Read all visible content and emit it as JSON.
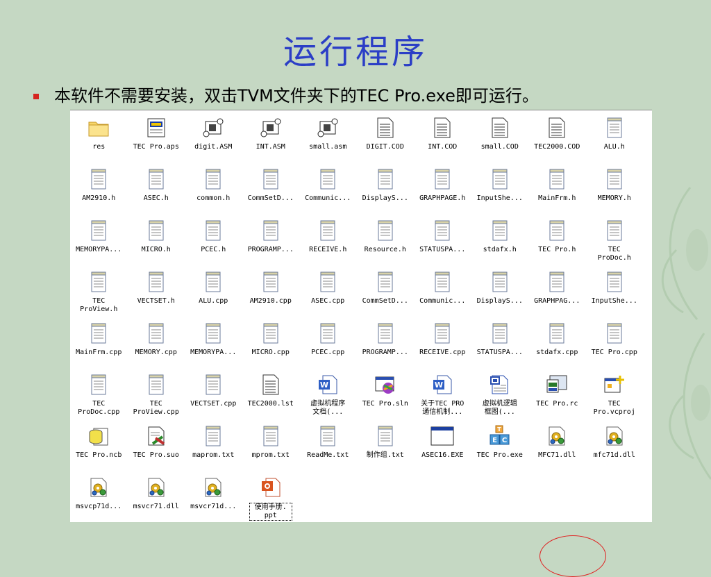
{
  "slide": {
    "title": "运行程序",
    "bullet_prefix": "本软件不需要安装，双击",
    "bullet_tvm": "TVM",
    "bullet_mid": "文件夹下的",
    "bullet_exe": "TEC Pro.exe",
    "bullet_suffix": "即可运行。"
  },
  "explorer": {
    "rows": [
      [
        {
          "label": "res",
          "icon": "folder"
        },
        {
          "label": "TEC Pro.aps",
          "icon": "aps"
        },
        {
          "label": "digit.ASM",
          "icon": "asm"
        },
        {
          "label": "INT.ASM",
          "icon": "asm"
        },
        {
          "label": "small.asm",
          "icon": "asm"
        },
        {
          "label": "DIGIT.COD",
          "icon": "doc"
        },
        {
          "label": "INT.COD",
          "icon": "doc"
        },
        {
          "label": "small.COD",
          "icon": "doc"
        },
        {
          "label": "TEC2000.COD",
          "icon": "doc"
        },
        {
          "label": "ALU.h",
          "icon": "note"
        }
      ],
      [
        {
          "label": "AM2910.h",
          "icon": "note"
        },
        {
          "label": "ASEC.h",
          "icon": "note"
        },
        {
          "label": "common.h",
          "icon": "note"
        },
        {
          "label": "CommSetD...",
          "icon": "note"
        },
        {
          "label": "Communic...",
          "icon": "note"
        },
        {
          "label": "DisplayS...",
          "icon": "note"
        },
        {
          "label": "GRAPHPAGE.h",
          "icon": "note"
        },
        {
          "label": "InputShe...",
          "icon": "note"
        },
        {
          "label": "MainFrm.h",
          "icon": "note"
        },
        {
          "label": "MEMORY.h",
          "icon": "note"
        }
      ],
      [
        {
          "label": "MEMORYPA...",
          "icon": "note"
        },
        {
          "label": "MICRO.h",
          "icon": "note"
        },
        {
          "label": "PCEC.h",
          "icon": "note"
        },
        {
          "label": "PROGRAMP...",
          "icon": "note"
        },
        {
          "label": "RECEIVE.h",
          "icon": "note"
        },
        {
          "label": "Resource.h",
          "icon": "note"
        },
        {
          "label": "STATUSPA...",
          "icon": "note"
        },
        {
          "label": "stdafx.h",
          "icon": "note"
        },
        {
          "label": "TEC Pro.h",
          "icon": "note"
        },
        {
          "label": "TEC\nProDoc.h",
          "icon": "note"
        }
      ],
      [
        {
          "label": "TEC\nProView.h",
          "icon": "note"
        },
        {
          "label": "VECTSET.h",
          "icon": "note"
        },
        {
          "label": "ALU.cpp",
          "icon": "note"
        },
        {
          "label": "AM2910.cpp",
          "icon": "note"
        },
        {
          "label": "ASEC.cpp",
          "icon": "note"
        },
        {
          "label": "CommSetD...",
          "icon": "note"
        },
        {
          "label": "Communic...",
          "icon": "note"
        },
        {
          "label": "DisplayS...",
          "icon": "note"
        },
        {
          "label": "GRAPHPAG...",
          "icon": "note"
        },
        {
          "label": "InputShe...",
          "icon": "note"
        }
      ],
      [
        {
          "label": "MainFrm.cpp",
          "icon": "note"
        },
        {
          "label": "MEMORY.cpp",
          "icon": "note"
        },
        {
          "label": "MEMORYPA...",
          "icon": "note"
        },
        {
          "label": "MICRO.cpp",
          "icon": "note"
        },
        {
          "label": "PCEC.cpp",
          "icon": "note"
        },
        {
          "label": "PROGRAMP...",
          "icon": "note"
        },
        {
          "label": "RECEIVE.cpp",
          "icon": "note"
        },
        {
          "label": "STATUSPA...",
          "icon": "note"
        },
        {
          "label": "stdafx.cpp",
          "icon": "note"
        },
        {
          "label": "TEC Pro.cpp",
          "icon": "note"
        }
      ],
      [
        {
          "label": "TEC\nProDoc.cpp",
          "icon": "note"
        },
        {
          "label": "TEC\nProView.cpp",
          "icon": "note"
        },
        {
          "label": "VECTSET.cpp",
          "icon": "note"
        },
        {
          "label": "TEC2000.lst",
          "icon": "doc"
        },
        {
          "label": "虚拟机程序\n文档(...",
          "icon": "word"
        },
        {
          "label": "TEC Pro.sln",
          "icon": "sln"
        },
        {
          "label": "关于TEC PRO\n通信机制...",
          "icon": "word"
        },
        {
          "label": "虚拟机逻辑\n框图(...",
          "icon": "diagram"
        },
        {
          "label": "TEC Pro.rc",
          "icon": "rc"
        },
        {
          "label": "TEC\nPro.vcproj",
          "icon": "vcproj"
        }
      ],
      [
        {
          "label": "TEC Pro.ncb",
          "icon": "db"
        },
        {
          "label": "TEC Pro.suo",
          "icon": "suo"
        },
        {
          "label": "maprom.txt",
          "icon": "note"
        },
        {
          "label": "mprom.txt",
          "icon": "note"
        },
        {
          "label": "ReadMe.txt",
          "icon": "note"
        },
        {
          "label": "制作组.txt",
          "icon": "note"
        },
        {
          "label": "ASEC16.EXE",
          "icon": "exe"
        },
        {
          "label": "TEC Pro.exe",
          "icon": "tec"
        },
        {
          "label": "MFC71.dll",
          "icon": "dll"
        },
        {
          "label": "mfc71d.dll",
          "icon": "dll"
        }
      ],
      [
        {
          "label": "msvcp71d...",
          "icon": "dll"
        },
        {
          "label": "msvcr71.dll",
          "icon": "dll"
        },
        {
          "label": "msvcr71d...",
          "icon": "dll"
        },
        {
          "label": "使用手册.\nppt",
          "icon": "ppt",
          "selected": true
        }
      ]
    ]
  },
  "colors": {
    "title": "#2b3ec6",
    "bullet": "#d5251f",
    "background": "#c5d8c3",
    "highlight": "#e02020"
  }
}
